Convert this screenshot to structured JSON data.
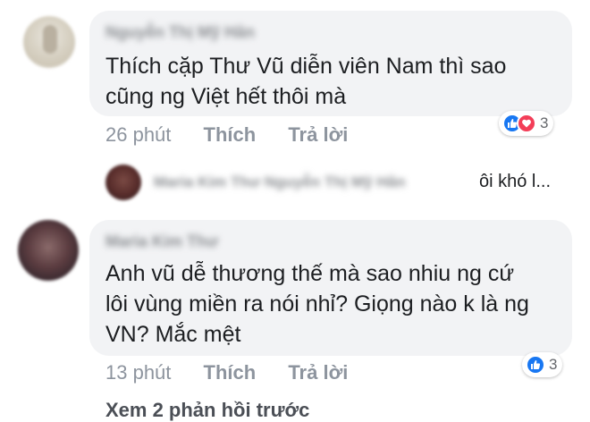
{
  "comment1": {
    "author": "Nguyễn Thị Mỹ Hân",
    "lines": [
      "Thích cặp Thư Vũ diễn viên Nam thì sao",
      "cũng ng Việt hết thôi mà"
    ],
    "time": "26 phút",
    "like_label": "Thích",
    "reply_label": "Trả lời",
    "reaction_count": "3",
    "reaction_icons": [
      "like-icon",
      "heart-icon"
    ]
  },
  "reply1": {
    "author": "Maria Kim Thư Nguyễn Thị Mỹ Hân",
    "preview": "ôi khó l..."
  },
  "comment2": {
    "author": "Maria Kim Thư",
    "lines": [
      "Anh vũ dễ thương thế mà sao nhiu ng cứ",
      "lôi vùng miền ra nói nhỉ? Giọng nào k là ng",
      "VN? Mắc mệt"
    ],
    "time": "13 phút",
    "like_label": "Thích",
    "reply_label": "Trả lời",
    "reaction_count": "3",
    "reaction_icons": [
      "like-icon"
    ]
  },
  "footer": {
    "more_replies": "Xem 2 phản hồi trước"
  },
  "colors": {
    "bubble": "#f2f3f5",
    "like_blue": "#1877f2",
    "heart_red": "#f33e58",
    "meta_gray": "#8d949e"
  }
}
